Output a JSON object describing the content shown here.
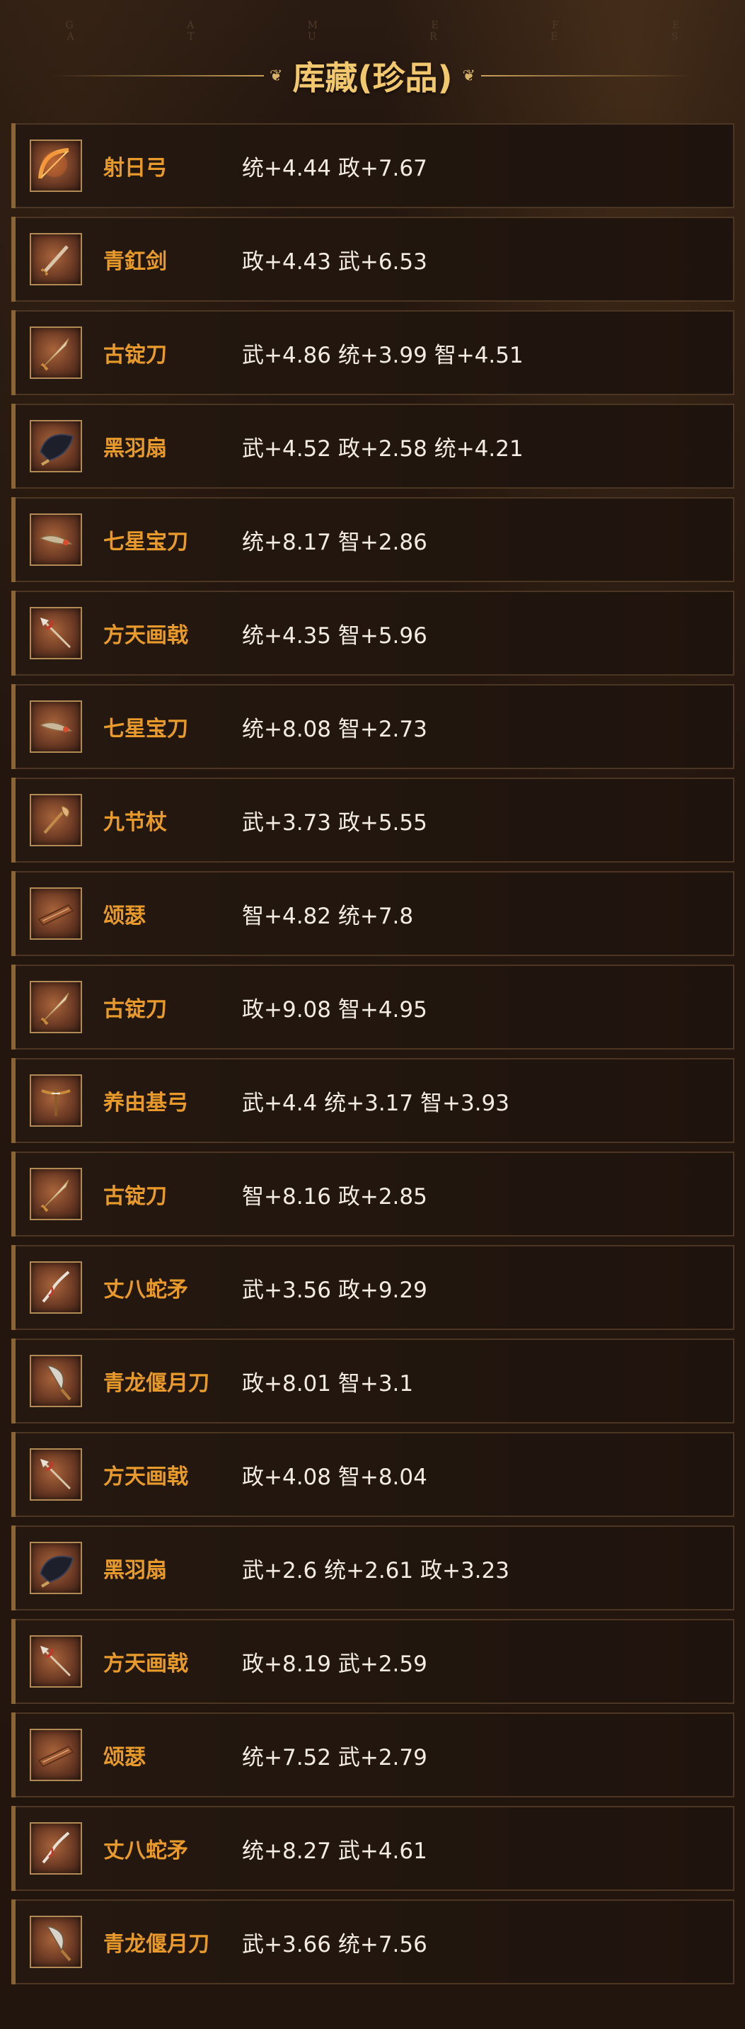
{
  "header": {
    "subtitle": "G A M E   F E A T U R E S",
    "title": "库藏(珍品)"
  },
  "items": [
    {
      "name": "射日弓",
      "stats": "统+4.44 政+7.67",
      "icon": "bow-icon"
    },
    {
      "name": "青釭剑",
      "stats": "政+4.43 武+6.53",
      "icon": "sword-icon"
    },
    {
      "name": "古锭刀",
      "stats": "武+4.86 统+3.99 智+4.51",
      "icon": "blade-icon"
    },
    {
      "name": "黑羽扇",
      "stats": "武+4.52 政+2.58 统+4.21",
      "icon": "feather-fan-icon"
    },
    {
      "name": "七星宝刀",
      "stats": "统+8.17 智+2.86",
      "icon": "dagger-icon"
    },
    {
      "name": "方天画戟",
      "stats": "统+4.35 智+5.96",
      "icon": "halberd-icon"
    },
    {
      "name": "七星宝刀",
      "stats": "统+8.08 智+2.73",
      "icon": "dagger-icon"
    },
    {
      "name": "九节杖",
      "stats": "武+3.73 政+5.55",
      "icon": "staff-icon"
    },
    {
      "name": "颂瑟",
      "stats": "智+4.82 统+7.8",
      "icon": "zither-icon"
    },
    {
      "name": "古锭刀",
      "stats": "政+9.08 智+4.95",
      "icon": "blade-icon"
    },
    {
      "name": "养由基弓",
      "stats": "武+4.4 统+3.17 智+3.93",
      "icon": "crossbow-icon"
    },
    {
      "name": "古锭刀",
      "stats": "智+8.16 政+2.85",
      "icon": "blade-icon"
    },
    {
      "name": "丈八蛇矛",
      "stats": "武+3.56 政+9.29",
      "icon": "serpent-spear-icon"
    },
    {
      "name": "青龙偃月刀",
      "stats": "政+8.01 智+3.1",
      "icon": "glaive-icon"
    },
    {
      "name": "方天画戟",
      "stats": "政+4.08 智+8.04",
      "icon": "halberd-icon"
    },
    {
      "name": "黑羽扇",
      "stats": "武+2.6 统+2.61 政+3.23",
      "icon": "feather-fan-icon"
    },
    {
      "name": "方天画戟",
      "stats": "政+8.19 武+2.59",
      "icon": "halberd-icon"
    },
    {
      "name": "颂瑟",
      "stats": "统+7.52 武+2.79",
      "icon": "zither-icon"
    },
    {
      "name": "丈八蛇矛",
      "stats": "统+8.27 武+4.61",
      "icon": "serpent-spear-icon"
    },
    {
      "name": "青龙偃月刀",
      "stats": "武+3.66 统+7.56",
      "icon": "glaive-icon"
    }
  ],
  "colors": {
    "background": "#22150e",
    "title": "#f2c86e",
    "item_name": "#e89a2a",
    "stats_text": "#f3ece3",
    "border": "#4a3622",
    "accent_bar": "#8a6435"
  }
}
